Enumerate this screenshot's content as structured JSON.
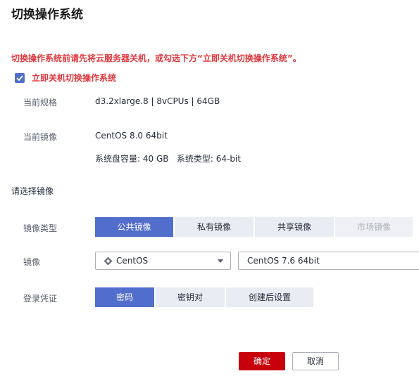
{
  "dialog": {
    "title": "切换操作系统",
    "warning": "切换操作系统前请先将云服务器关机，或勾选下方“立即关机切换操作系统”。",
    "shutdown_checkbox": {
      "label": "立即关机切换操作系统",
      "checked": true
    }
  },
  "spec": {
    "label": "当前规格",
    "value": "d3.2xlarge.8 | 8vCPUs | 64GB"
  },
  "current_image": {
    "label": "当前镜像",
    "value": "CentOS 8.0 64bit",
    "details": "系统盘容量: 40 GB   系统类型: 64-bit"
  },
  "select_section": {
    "title": "请选择镜像"
  },
  "image_type": {
    "label": "镜像类型",
    "options": [
      "公共镜像",
      "私有镜像",
      "共享镜像",
      "市场镜像"
    ],
    "selected": "公共镜像",
    "disabled": [
      "市场镜像"
    ]
  },
  "image": {
    "label": "镜像",
    "os_select": {
      "value": "CentOS",
      "icon": "gear-icon"
    },
    "version_value": "CentOS 7.6 64bit"
  },
  "login": {
    "label": "登录凭证",
    "options": [
      "密码",
      "密钥对",
      "创建后设置"
    ],
    "selected": "密码"
  },
  "buttons": {
    "confirm": "确定",
    "cancel": "取消"
  },
  "colors": {
    "accent": "#526ecc",
    "danger": "#e0393e",
    "primary_button": "#c7000b"
  }
}
